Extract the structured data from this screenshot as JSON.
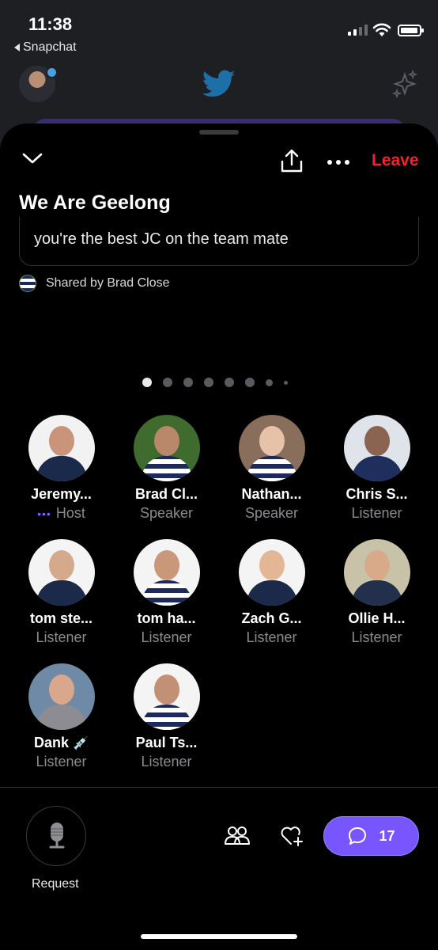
{
  "status_bar": {
    "time": "11:38",
    "back_app": "Snapchat"
  },
  "space": {
    "title": "We Are Geelong",
    "leave_label": "Leave",
    "shared_tweet_text": "you're the best JC on the team mate",
    "shared_by": "Shared by Brad Close",
    "page_dots_total": 8,
    "page_dots_active": 1
  },
  "participants": [
    {
      "name": "Jeremy...",
      "role": "Host"
    },
    {
      "name": "Brad Cl...",
      "role": "Speaker"
    },
    {
      "name": "Nathan...",
      "role": "Speaker"
    },
    {
      "name": "Chris S...",
      "role": "Listener"
    },
    {
      "name": "tom ste...",
      "role": "Listener"
    },
    {
      "name": "tom ha...",
      "role": "Listener"
    },
    {
      "name": "Zach G...",
      "role": "Listener"
    },
    {
      "name": "Ollie H...",
      "role": "Listener"
    },
    {
      "name": "Dank",
      "role": "Listener",
      "emoji": "💉"
    },
    {
      "name": "Paul Ts...",
      "role": "Listener"
    }
  ],
  "footer": {
    "request_label": "Request",
    "comment_count": "17"
  },
  "colors": {
    "accent": "#7856ff",
    "leave": "#f4212e",
    "twitter_blue": "#1d9bf0"
  },
  "icons": [
    "chevron-down-icon",
    "share-icon",
    "more-icon",
    "microphone-icon",
    "people-icon",
    "heart-plus-icon",
    "comment-icon",
    "twitter-bird-icon",
    "sparkle-icon"
  ]
}
